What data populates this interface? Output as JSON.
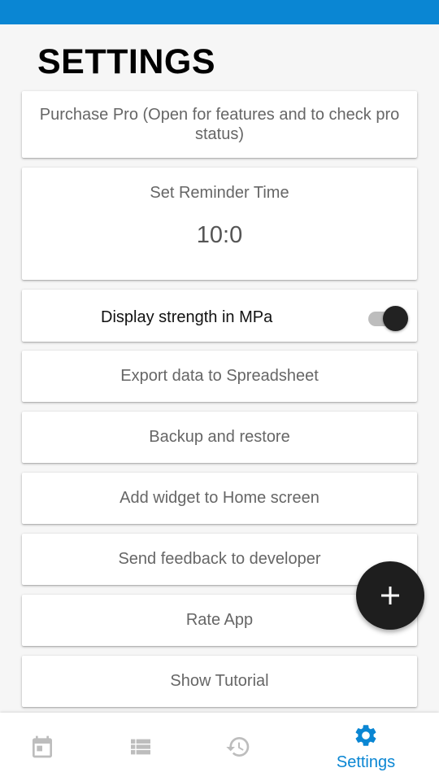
{
  "page": {
    "title": "SETTINGS"
  },
  "colors": {
    "accent": "#0a86d3",
    "fab": "#1e1e1e",
    "icon_inactive": "#bdbdbd"
  },
  "settings": {
    "purchase_pro": "Purchase Pro (Open for features and to check pro status)",
    "reminder_label": "Set Reminder Time",
    "reminder_time": "10:0",
    "display_strength_label": "Display strength in MPa",
    "display_strength_enabled": true,
    "export_label": "Export data to Spreadsheet",
    "backup_label": "Backup and restore",
    "widget_label": "Add widget to Home screen",
    "feedback_label": "Send feedback to developer",
    "rate_label": "Rate App",
    "tutorial_label": "Show Tutorial"
  },
  "fab": {
    "icon": "plus-icon"
  },
  "bottom_nav": {
    "items": [
      {
        "icon": "calendar-icon",
        "label": "",
        "active": false
      },
      {
        "icon": "list-icon",
        "label": "",
        "active": false
      },
      {
        "icon": "history-icon",
        "label": "",
        "active": false
      },
      {
        "icon": "gear-icon",
        "label": "Settings",
        "active": true
      }
    ]
  }
}
